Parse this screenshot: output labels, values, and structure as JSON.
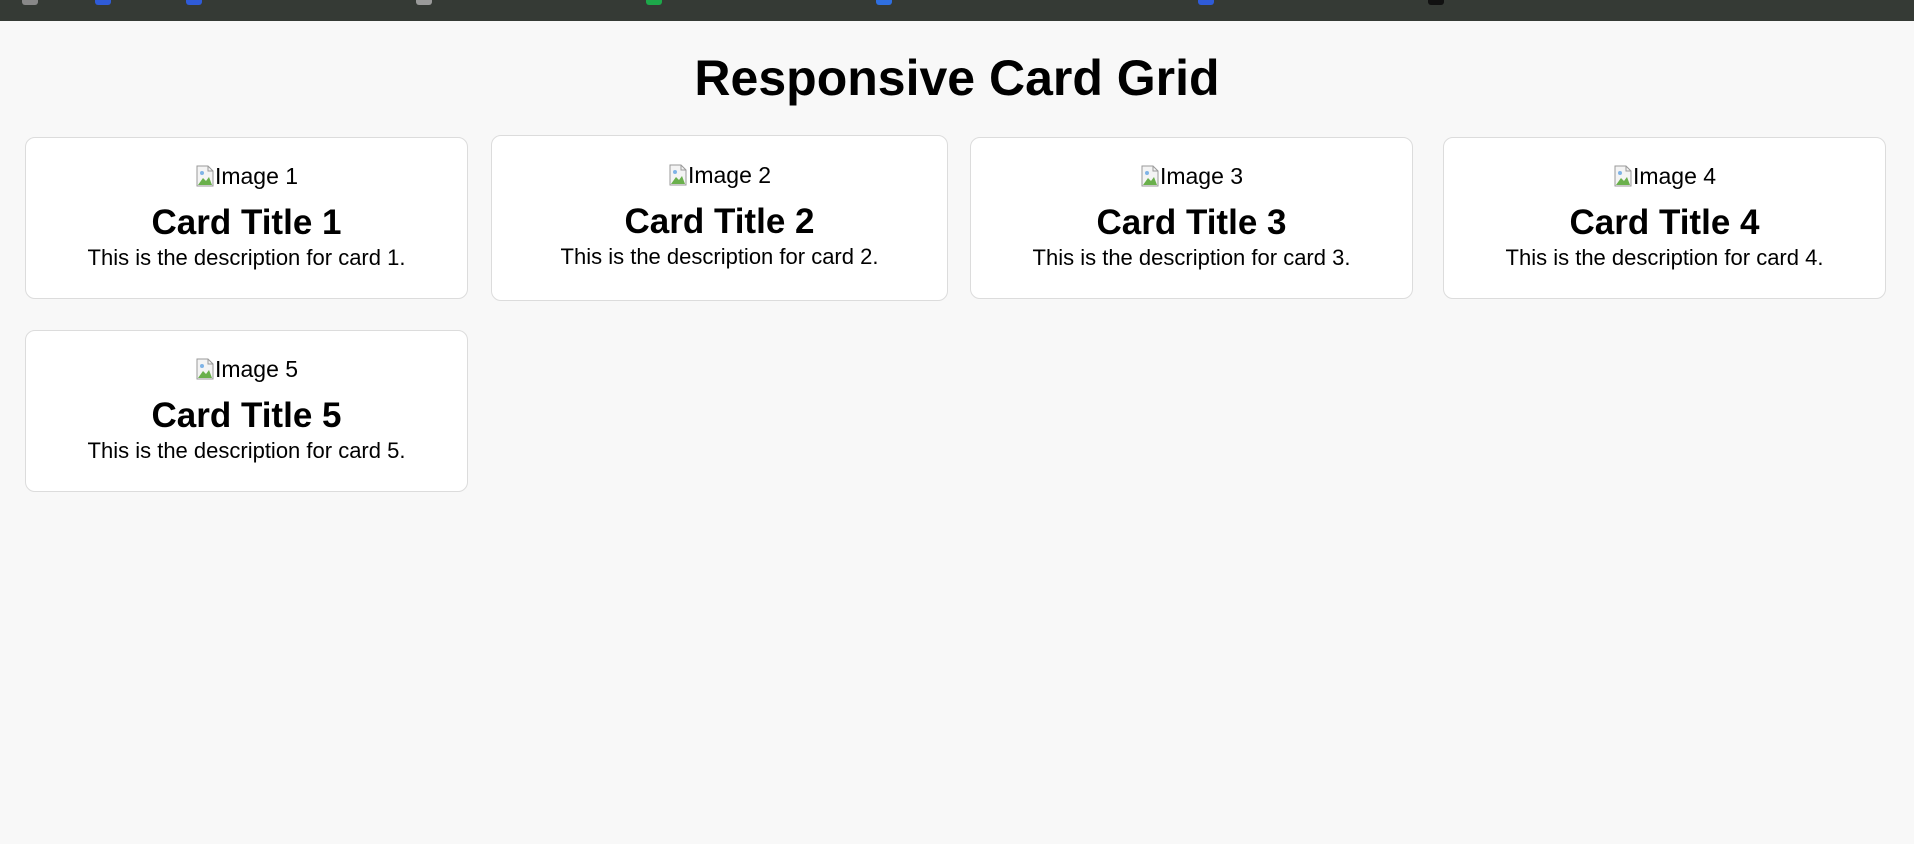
{
  "header": {
    "title": "Responsive Card Grid"
  },
  "cards": [
    {
      "image_alt": "Image 1",
      "title": "Card Title 1",
      "description": "This is the description for card 1."
    },
    {
      "image_alt": "Image 2",
      "title": "Card Title 2",
      "description": "This is the description for card 2."
    },
    {
      "image_alt": "Image 3",
      "title": "Card Title 3",
      "description": "This is the description for card 3."
    },
    {
      "image_alt": "Image 4",
      "title": "Card Title 4",
      "description": "This is the description for card 4."
    },
    {
      "image_alt": "Image 5",
      "title": "Card Title 5",
      "description": "This is the description for card 5."
    }
  ],
  "colors": {
    "page_background": "#f8f8f8",
    "card_background": "#ffffff",
    "card_border": "#dcdcdc",
    "topbar": "#353a35"
  },
  "icons": {
    "image_placeholder": "broken-image-icon"
  }
}
